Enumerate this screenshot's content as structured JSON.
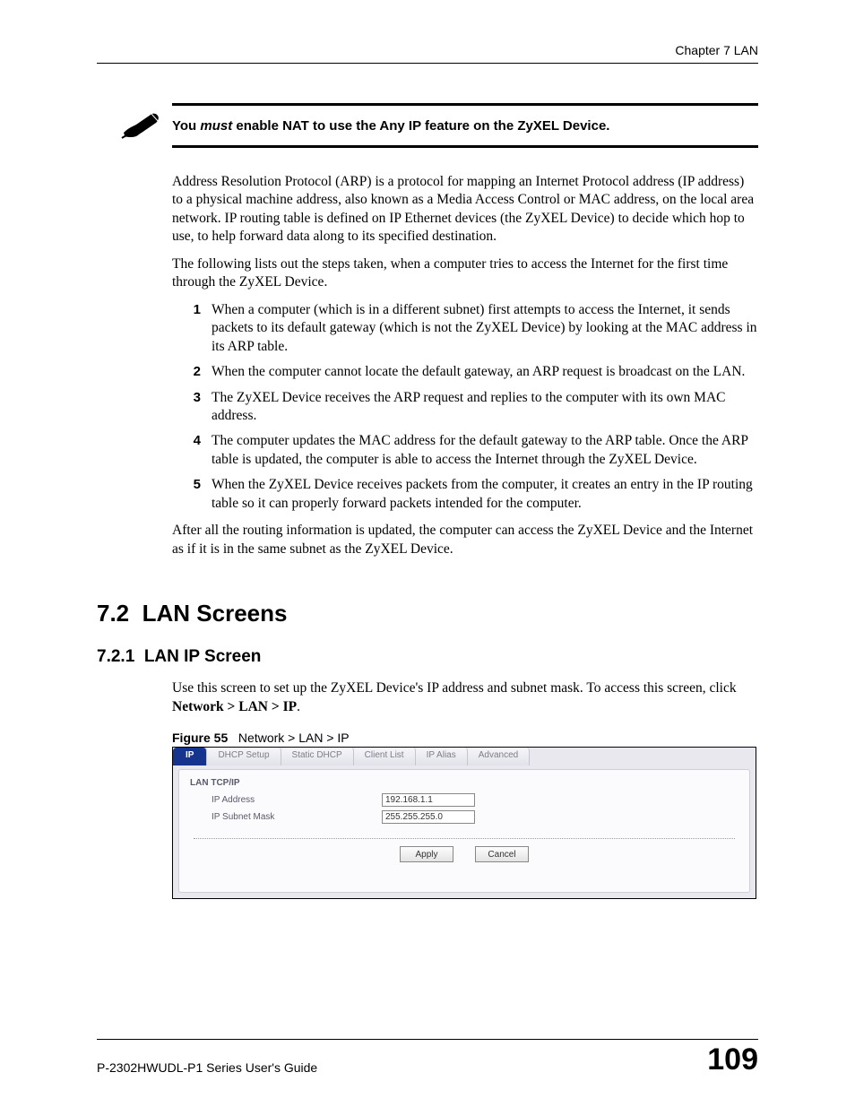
{
  "header": {
    "chapter": "Chapter 7 LAN"
  },
  "note": {
    "prefix": "You ",
    "italic": "must",
    "suffix": " enable NAT to use the Any IP feature on the ZyXEL Device."
  },
  "para1": "Address Resolution Protocol (ARP) is a protocol for mapping an Internet Protocol address (IP address) to a physical machine address, also known as a Media Access Control or MAC address, on the local area network. IP routing table is defined on IP Ethernet devices (the ZyXEL Device) to decide which hop to use, to help forward data along to its specified destination.",
  "para2": "The following lists out the steps taken, when a computer tries to access the Internet for the first time through the ZyXEL Device.",
  "steps": [
    "When a computer (which is in a different subnet) first attempts to access the Internet, it sends packets to its default gateway (which is not the ZyXEL Device) by looking at the MAC address in its ARP table.",
    "When the computer cannot locate the default gateway, an ARP request is broadcast on the LAN.",
    "The ZyXEL Device receives the ARP request and replies to the computer with its own MAC address.",
    "The computer updates the MAC address for the default gateway to the ARP table. Once the ARP table is updated, the computer is able to access the Internet through the ZyXEL Device.",
    "When the ZyXEL Device receives packets from the computer, it creates an entry in the IP routing table so it can properly forward packets intended for the computer."
  ],
  "para3": "After all the routing information is updated, the computer can access the ZyXEL Device and the Internet as if it is in the same subnet as the ZyXEL Device.",
  "sec": {
    "num": "7.2",
    "title": "LAN Screens"
  },
  "subsec": {
    "num": "7.2.1",
    "title": "LAN IP Screen"
  },
  "para4_a": "Use this screen to set up the ZyXEL Device's IP address and subnet mask. To access this screen, click ",
  "para4_nav": "Network > LAN > IP",
  "para4_b": ".",
  "figure": {
    "label": "Figure 55",
    "caption": "Network > LAN > IP",
    "tabs": [
      "IP",
      "DHCP Setup",
      "Static DHCP",
      "Client List",
      "IP Alias",
      "Advanced"
    ],
    "section_label": "LAN TCP/IP",
    "fields": {
      "ip_label": "IP Address",
      "ip_value": "192.168.1.1",
      "mask_label": "IP Subnet Mask",
      "mask_value": "255.255.255.0"
    },
    "buttons": {
      "apply": "Apply",
      "cancel": "Cancel"
    }
  },
  "footer": {
    "guide": "P-2302HWUDL-P1 Series User's Guide",
    "page": "109"
  }
}
